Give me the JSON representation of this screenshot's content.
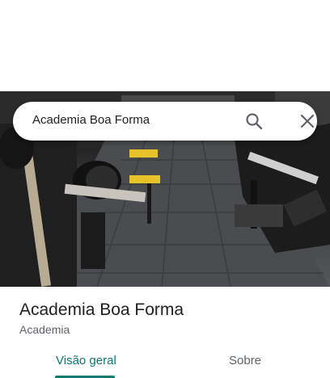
{
  "search": {
    "query": "Academia Boa Forma"
  },
  "place": {
    "name": "Academia Boa Forma",
    "category": "Academia"
  },
  "tabs": [
    {
      "label": "Visão geral",
      "selected": true
    },
    {
      "label": "Sobre",
      "selected": false
    }
  ],
  "colors": {
    "accent": "#0b7a70",
    "title": "#202124",
    "secondary": "#5f6368"
  }
}
